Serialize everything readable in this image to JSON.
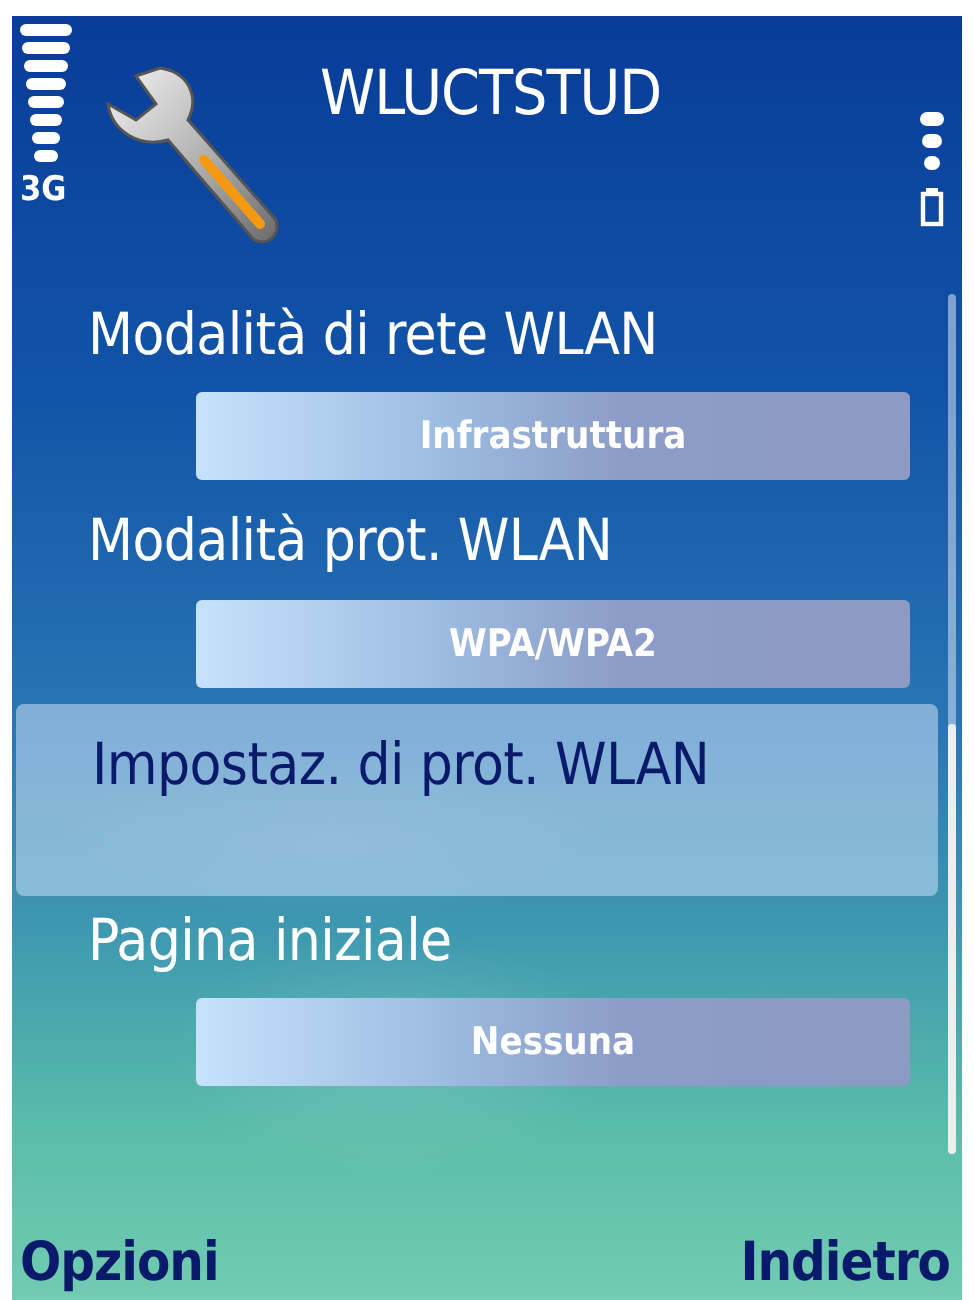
{
  "status_pane": {
    "network": "3G",
    "title": "WLUCTSTUD"
  },
  "settings": [
    {
      "label": "Modalità di rete WLAN",
      "value": "Infrastruttura",
      "selected": false
    },
    {
      "label": "Modalità prot. WLAN",
      "value": "WPA/WPA2",
      "selected": false
    },
    {
      "label": "Impostaz. di prot. WLAN",
      "selected": true
    },
    {
      "label": "Pagina iniziale",
      "value": "Nessuna",
      "selected": false
    }
  ],
  "softkeys": {
    "left": "Opzioni",
    "right": "Indietro"
  }
}
